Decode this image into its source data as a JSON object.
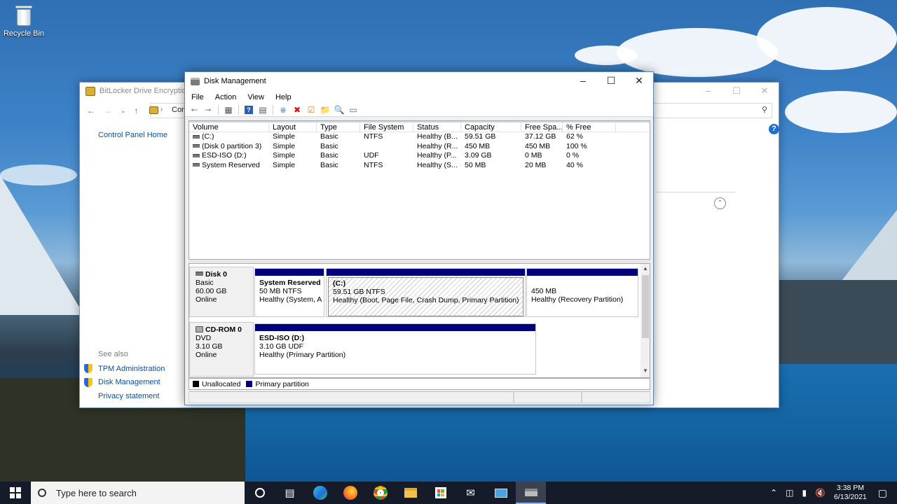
{
  "desktop": {
    "recycle_bin_label": "Recycle Bin"
  },
  "bitlocker": {
    "title": "BitLocker Drive Encryption",
    "address_text": "Con",
    "control_panel_home": "Control Panel Home",
    "see_also": "See also",
    "links": [
      "TPM Administration",
      "Disk Management",
      "Privacy statement"
    ]
  },
  "disk_management": {
    "title": "Disk Management",
    "menu": [
      "File",
      "Action",
      "View",
      "Help"
    ],
    "columns": [
      "Volume",
      "Layout",
      "Type",
      "File System",
      "Status",
      "Capacity",
      "Free Spa...",
      "% Free"
    ],
    "volumes": [
      [
        "(C:)",
        "Simple",
        "Basic",
        "NTFS",
        "Healthy (B...",
        "59.51 GB",
        "37.12 GB",
        "62 %"
      ],
      [
        "(Disk 0 partition 3)",
        "Simple",
        "Basic",
        "",
        "Healthy (R...",
        "450 MB",
        "450 MB",
        "100 %"
      ],
      [
        "ESD-ISO (D:)",
        "Simple",
        "Basic",
        "UDF",
        "Healthy (P...",
        "3.09 GB",
        "0 MB",
        "0 %"
      ],
      [
        "System Reserved",
        "Simple",
        "Basic",
        "NTFS",
        "Healthy (S...",
        "50 MB",
        "20 MB",
        "40 %"
      ]
    ],
    "disk0": {
      "name": "Disk 0",
      "type": "Basic",
      "size": "60.00 GB",
      "state": "Online",
      "partitions": [
        {
          "name": "System Reserved",
          "size": "50 MB NTFS",
          "status": "Healthy (System, A"
        },
        {
          "name": "(C:)",
          "size": "59.51 GB NTFS",
          "status": "Healthy (Boot, Page File, Crash Dump, Primary Partition)"
        },
        {
          "name": "",
          "size": "450 MB",
          "status": "Healthy (Recovery Partition)"
        }
      ]
    },
    "cdrom0": {
      "name": "CD-ROM 0",
      "type": "DVD",
      "size": "3.10 GB",
      "state": "Online",
      "partition": {
        "name": "ESD-ISO  (D:)",
        "size": "3.10 GB UDF",
        "status": "Healthy (Primary Partition)"
      }
    },
    "legend": {
      "unallocated": "Unallocated",
      "primary": "Primary partition"
    },
    "colors": {
      "primary": "#00007f",
      "unallocated": "#000000"
    }
  },
  "taskbar": {
    "search_placeholder": "Type here to search",
    "time": "3:38 PM",
    "date": "6/13/2021"
  }
}
